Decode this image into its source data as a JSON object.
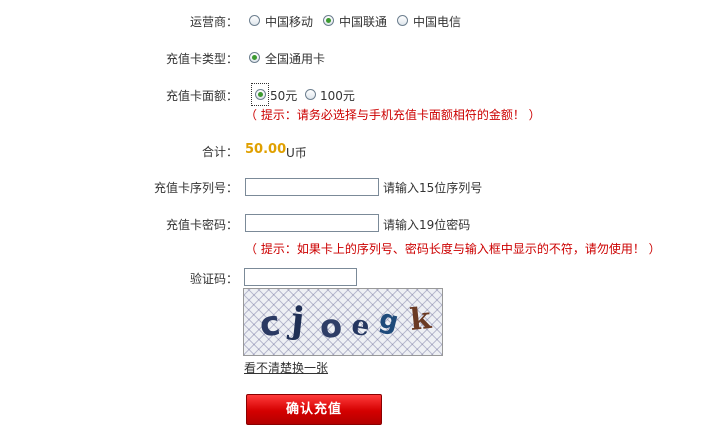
{
  "operator": {
    "label": "运营商：",
    "options": [
      "中国移动",
      "中国联通",
      "中国电信"
    ],
    "selected": 1
  },
  "card_type": {
    "label": "充值卡类型：",
    "options": [
      "全国通用卡"
    ],
    "selected": 0
  },
  "face_value": {
    "label": "充值卡面额：",
    "options": [
      "50元",
      "100元"
    ],
    "selected": 0,
    "hint": "（ 提示：请务必选择与手机充值卡面额相符的金额！ ）"
  },
  "total": {
    "label": "合计：",
    "amount": "50.00",
    "unit": "U币"
  },
  "serial": {
    "label": "充值卡序列号：",
    "value": "",
    "note": "请输入15位序列号"
  },
  "password": {
    "label": "充值卡密码：",
    "value": "",
    "note": "请输入19位密码",
    "hint": "（ 提示：如果卡上的序列号、密码长度与输入框中显示的不符，请勿使用！ ）"
  },
  "captcha": {
    "label": "验证码：",
    "value": "",
    "image_chars": "cjoegk",
    "refresh_label": "看不清楚换一张"
  },
  "submit": {
    "label": "确认充值"
  },
  "colors": {
    "hint": "#cc0000",
    "amount": "#e0a000",
    "button": "#d40000",
    "radio_checked": "#3c9a2f"
  }
}
